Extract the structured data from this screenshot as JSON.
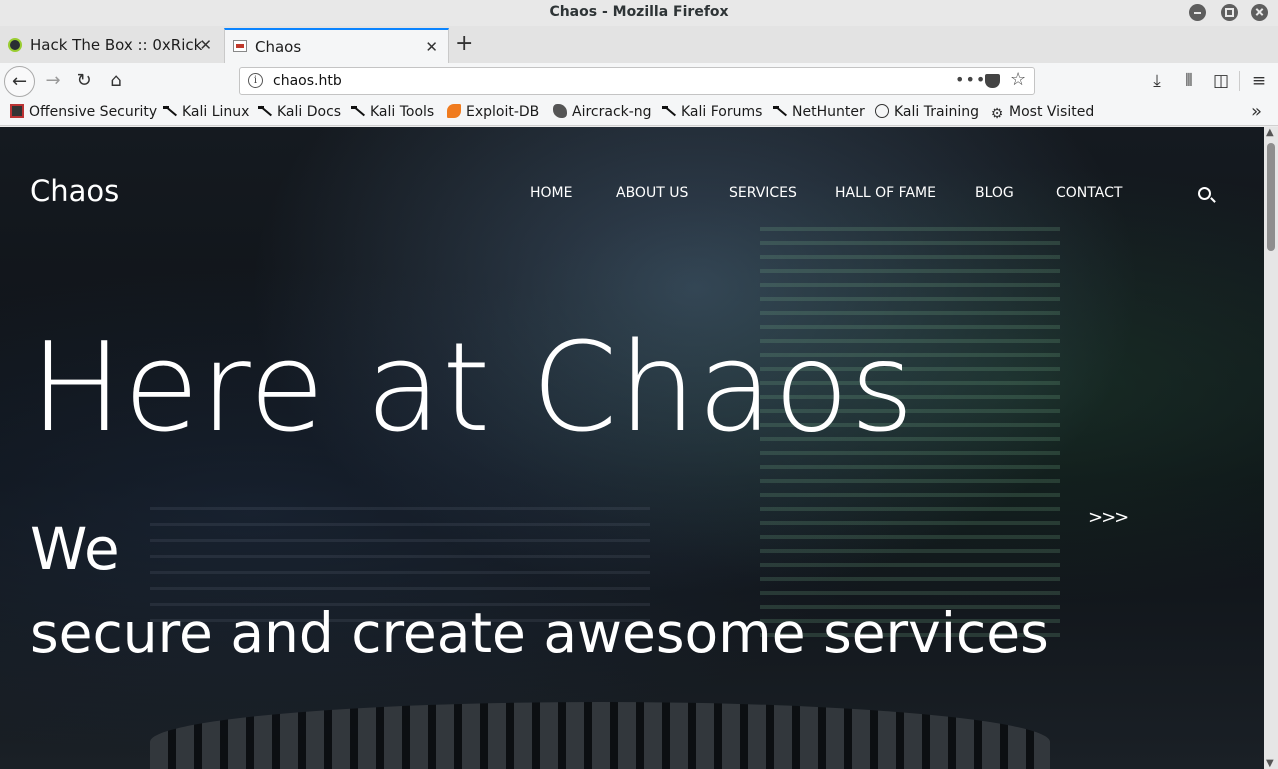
{
  "window": {
    "title": "Chaos - Mozilla Firefox"
  },
  "tabs": [
    {
      "label": "Hack The Box :: 0xRick",
      "favicon": "htb-icon",
      "active": false
    },
    {
      "label": "Chaos",
      "favicon": "chaos-favicon",
      "active": true
    }
  ],
  "nav": {
    "url": "chaos.htb",
    "more": "•••"
  },
  "bookmarks": [
    {
      "label": "Offensive Security",
      "icon": "offsec-icon"
    },
    {
      "label": "Kali Linux",
      "icon": "kali-icon"
    },
    {
      "label": "Kali Docs",
      "icon": "kali-icon"
    },
    {
      "label": "Kali Tools",
      "icon": "kali-icon"
    },
    {
      "label": "Exploit-DB",
      "icon": "exploitdb-icon"
    },
    {
      "label": "Aircrack-ng",
      "icon": "aircrack-icon"
    },
    {
      "label": "Kali Forums",
      "icon": "kali-icon"
    },
    {
      "label": "NetHunter",
      "icon": "kali-icon"
    },
    {
      "label": "Kali Training",
      "icon": "globe-icon"
    },
    {
      "label": "Most Visited",
      "icon": "gear-icon"
    }
  ],
  "site": {
    "brand": "Chaos",
    "menu": [
      "HOME",
      "ABOUT US",
      "SERVICES",
      "HALL OF FAME",
      "BLOG",
      "CONTACT"
    ],
    "hero_title": "Here at Chaos",
    "hero_we": "We",
    "hero_tagline": "secure and create awesome services",
    "slider_next": ">>>"
  },
  "colors": {
    "tab_accent": "#0a84ff",
    "hero_text": "#ffffff"
  }
}
